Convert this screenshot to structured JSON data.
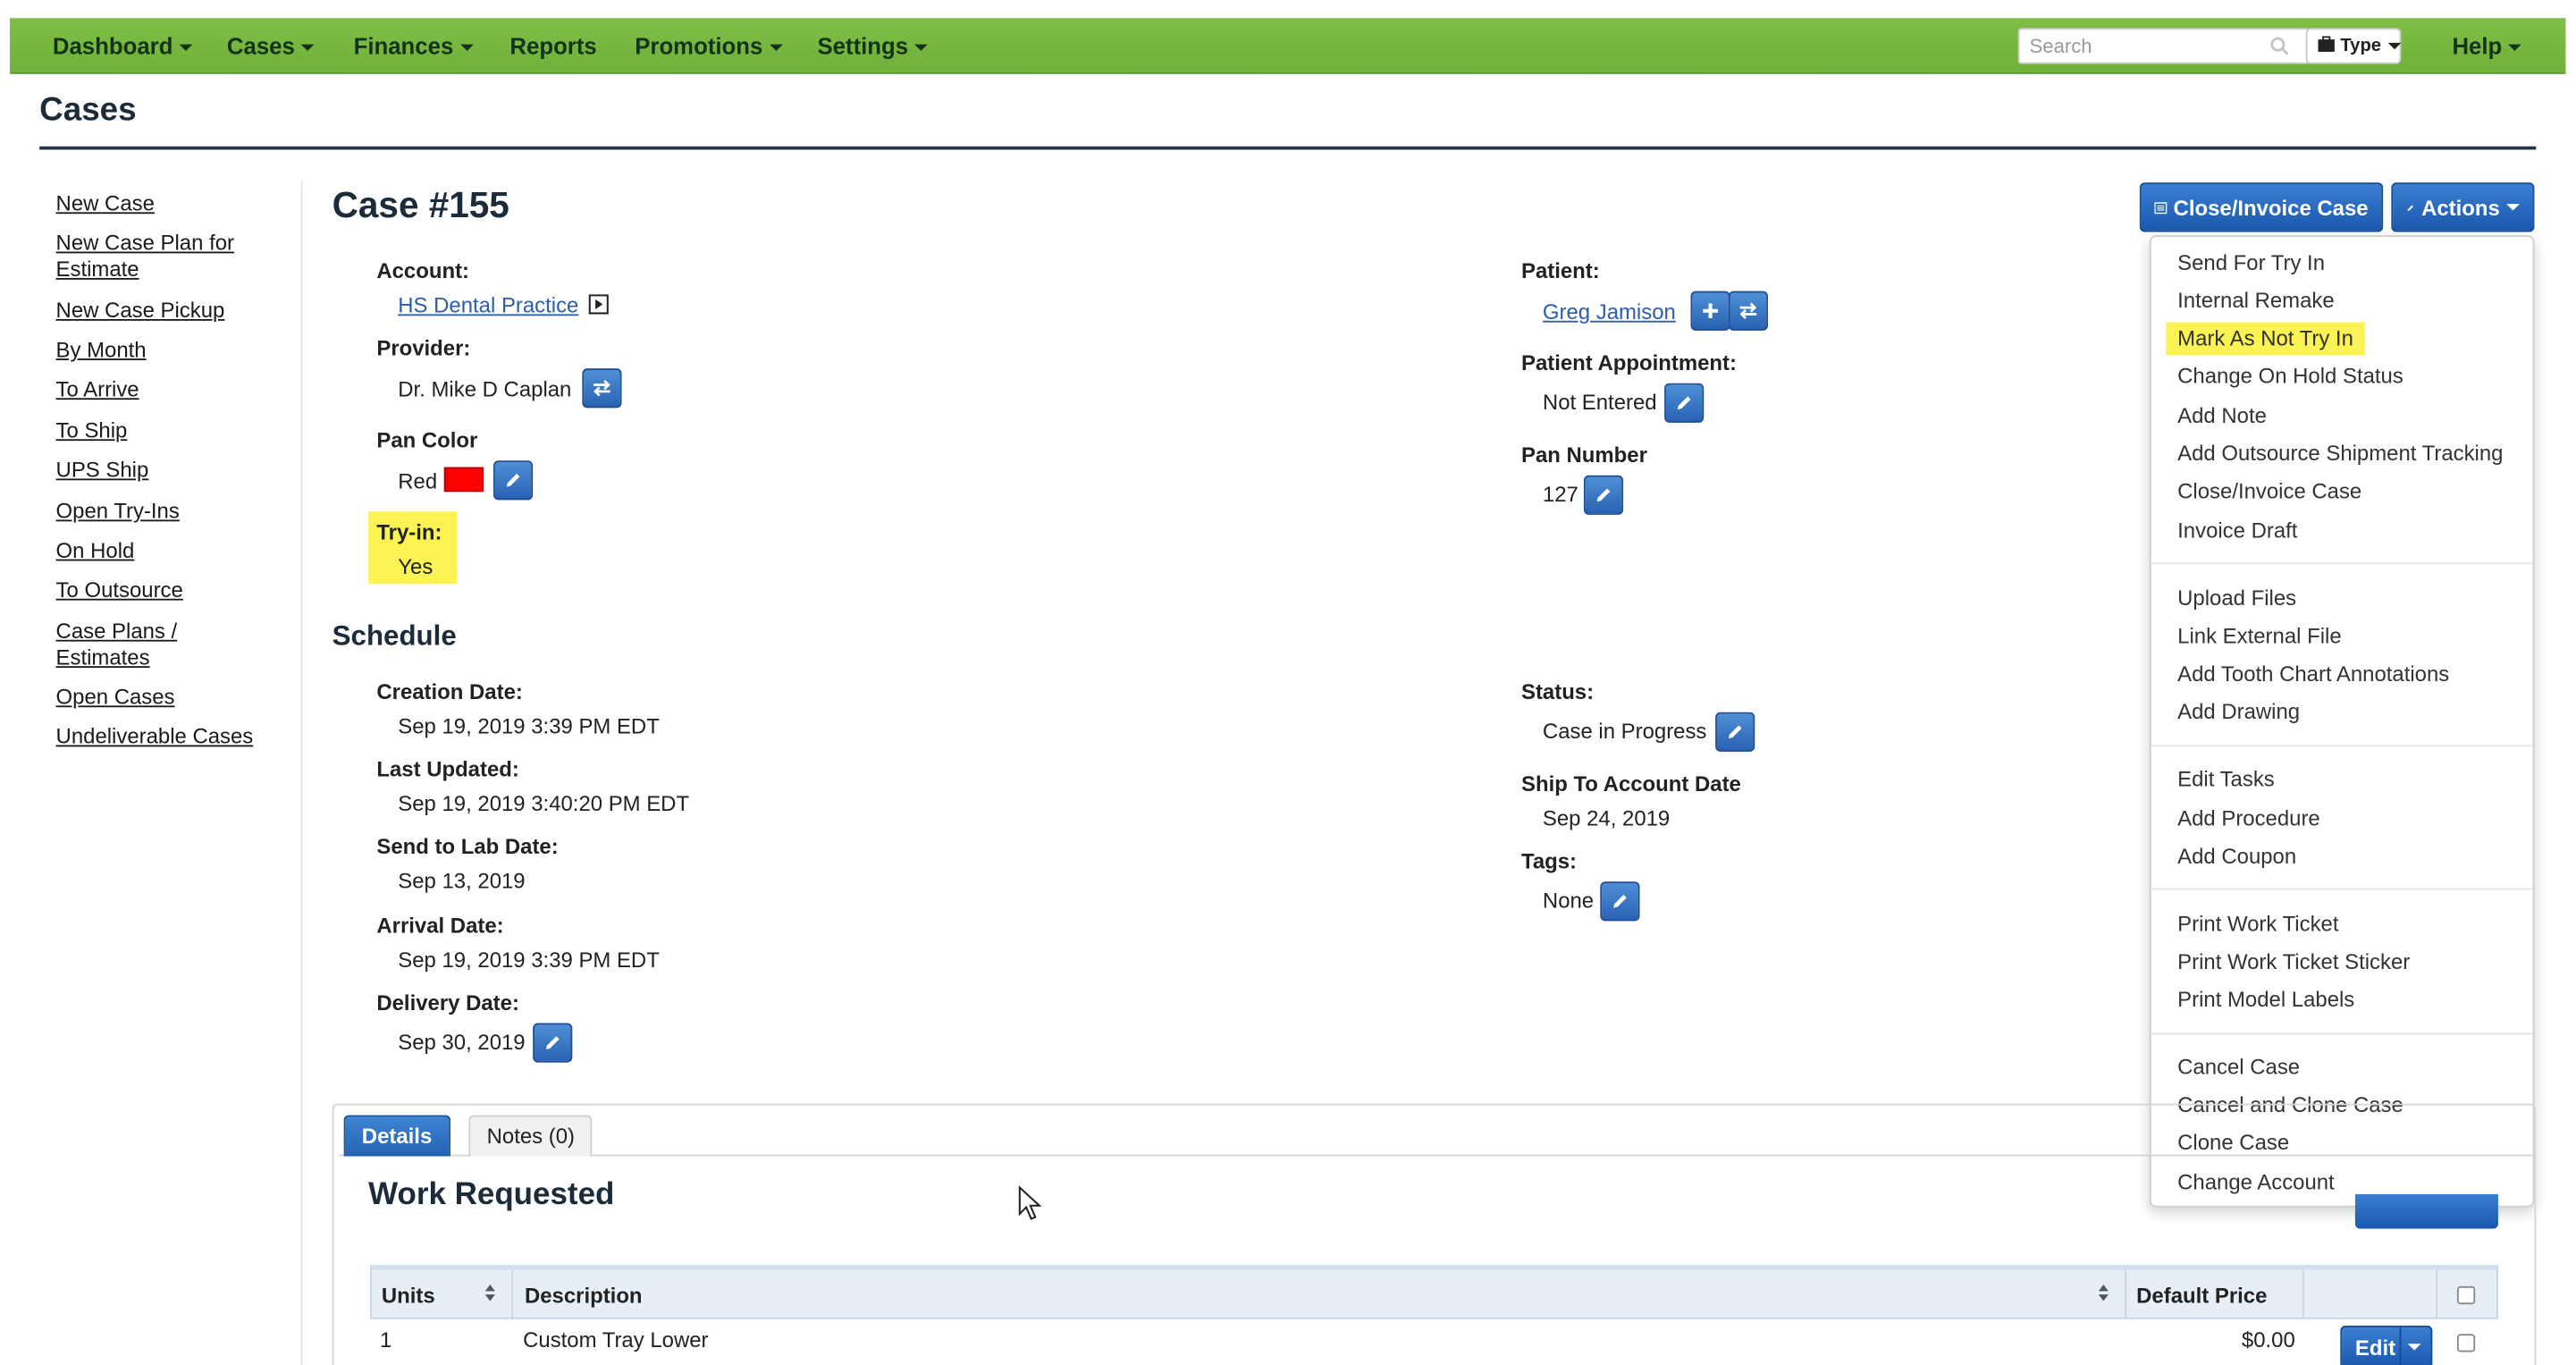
{
  "nav": {
    "items": [
      {
        "label": "Dashboard",
        "caret": true
      },
      {
        "label": "Cases",
        "caret": true
      },
      {
        "label": "Finances",
        "caret": true
      },
      {
        "label": "Reports",
        "caret": false
      },
      {
        "label": "Promotions",
        "caret": true
      },
      {
        "label": "Settings",
        "caret": true
      }
    ],
    "search_placeholder": "Search",
    "type_label": "Type",
    "help_label": "Help"
  },
  "page": {
    "title": "Cases"
  },
  "sidebar": {
    "links": [
      "New Case",
      "New Case Plan for Estimate",
      "New Case Pickup",
      "By Month",
      "To Arrive",
      "To Ship",
      "UPS Ship",
      "Open Try-Ins",
      "On Hold",
      "To Outsource",
      "Case Plans / Estimates",
      "Open Cases",
      "Undeliverable Cases"
    ]
  },
  "case": {
    "title": "Case #155",
    "account_label": "Account:",
    "account_value": "HS Dental Practice",
    "provider_label": "Provider:",
    "provider_value": "Dr. Mike D Caplan",
    "pan_color_label": "Pan Color",
    "pan_color_value": "Red",
    "pan_color_hex": "#ff0000",
    "tryin_label": "Try-in:",
    "tryin_value": "Yes",
    "patient_label": "Patient:",
    "patient_value": "Greg Jamison",
    "appointment_label": "Patient Appointment:",
    "appointment_value": "Not Entered",
    "pan_number_label": "Pan Number",
    "pan_number_value": "127"
  },
  "schedule": {
    "title": "Schedule",
    "creation_label": "Creation Date:",
    "creation_value": "Sep 19, 2019 3:39 PM EDT",
    "updated_label": "Last Updated:",
    "updated_value": "Sep 19, 2019 3:40:20 PM EDT",
    "sendlab_label": "Send to Lab Date:",
    "sendlab_value": "Sep 13, 2019",
    "arrival_label": "Arrival Date:",
    "arrival_value": "Sep 19, 2019 3:39 PM EDT",
    "delivery_label": "Delivery Date:",
    "delivery_value": "Sep 30, 2019",
    "status_label": "Status:",
    "status_value": "Case in Progress",
    "ship_label": "Ship To Account Date",
    "ship_value": "Sep 24, 2019",
    "tags_label": "Tags:",
    "tags_value": "None"
  },
  "buttons": {
    "close_invoice": "Close/Invoice Case",
    "actions": "Actions"
  },
  "actions_menu": {
    "highlighted": "Mark As Not Try In",
    "groups": [
      [
        "Send For Try In",
        "Internal Remake",
        "Mark As Not Try In",
        "Change On Hold Status",
        "Add Note",
        "Add Outsource Shipment Tracking",
        "Close/Invoice Case",
        "Invoice Draft"
      ],
      [
        "Upload Files",
        "Link External File",
        "Add Tooth Chart Annotations",
        "Add Drawing"
      ],
      [
        "Edit Tasks",
        "Add Procedure",
        "Add Coupon"
      ],
      [
        "Print Work Ticket",
        "Print Work Ticket Sticker",
        "Print Model Labels"
      ],
      [
        "Cancel Case",
        "Cancel and Clone Case",
        "Clone Case",
        "Change Account"
      ]
    ]
  },
  "tabs": [
    {
      "label": "Details",
      "active": true
    },
    {
      "label": "Notes (0)",
      "active": false
    }
  ],
  "work": {
    "title": "Work Requested",
    "columns": [
      "Units",
      "Description",
      "Default Price"
    ],
    "rows": [
      {
        "units": "1",
        "description": "Custom Tray Lower",
        "price": "$0.00",
        "action": "Edit"
      }
    ]
  },
  "colors": {
    "nav_green": "#7cb342",
    "accent_blue": "#2a62b3",
    "highlight_yellow": "#fbf254"
  }
}
